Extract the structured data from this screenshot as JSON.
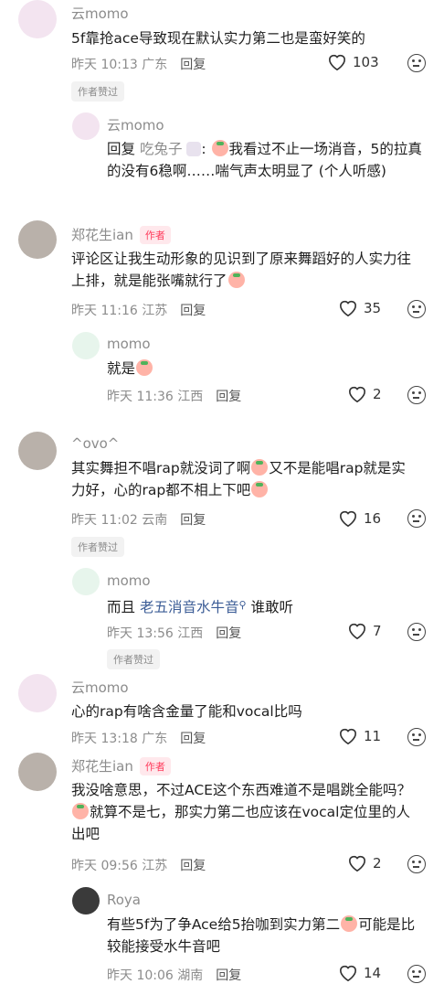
{
  "comments": [
    {
      "name": "云momo",
      "text": "5f靠抢ace导致现在默认实力第二也是蛮好笑的",
      "time": "昨天 10:13",
      "location": "广东",
      "reply_label": "回复",
      "likes": "103",
      "badge": "作者赞过"
    },
    {
      "name": "云momo",
      "reply_prefix": "回复 ",
      "reply_to": "吃兔子",
      "text": "我看过不止一场消音，5的拉真的没有6稳啊……喘气声太明显了 (个人听感)"
    },
    {
      "name": "郑花生ian",
      "author_tag": "作者",
      "text": "评论区让我生动形象的见识到了原来舞蹈好的人实力往上排，就是能张嘴就行了",
      "time": "昨天 11:16",
      "location": "江苏",
      "reply_label": "回复",
      "likes": "35"
    },
    {
      "name": "momo",
      "text": "就是",
      "time": "昨天 11:36",
      "location": "江西",
      "reply_label": "回复",
      "likes": "2"
    },
    {
      "name": "^ovo^",
      "text_a": "其实舞担不唱rap就没词了啊",
      "text_b": "又不是能唱rap就是实力好，心的rap都不相上下吧",
      "time": "昨天 11:02",
      "location": "云南",
      "reply_label": "回复",
      "likes": "16",
      "badge": "作者赞过"
    },
    {
      "name": "momo",
      "text_prefix": "而且 ",
      "link": "老五消音水牛音",
      "text_suffix": " 谁敢听",
      "time": "昨天 13:56",
      "location": "江西",
      "reply_label": "回复",
      "likes": "7",
      "badge": "作者赞过"
    },
    {
      "name": "云momo",
      "text": "心的rap有啥含金量了能和vocal比吗",
      "time": "昨天 13:18",
      "location": "广东",
      "reply_label": "回复",
      "likes": "11"
    },
    {
      "name": "郑花生ian",
      "author_tag": "作者",
      "text_a": "我没啥意思，不过ACE这个东西难道不是唱跳全能吗？",
      "text_b": "就算不是七，那实力第二也应该在vocal定位里的人出吧",
      "time": "昨天 09:56",
      "location": "江苏",
      "reply_label": "回复",
      "likes": "2"
    },
    {
      "name": "Roya",
      "text_a": "有些5f为了争Ace给5抬咖到实力第二",
      "text_b": "可能是比较能接受水牛音吧",
      "time": "昨天 10:06",
      "location": "湖南",
      "reply_label": "回复",
      "likes": "14"
    }
  ]
}
